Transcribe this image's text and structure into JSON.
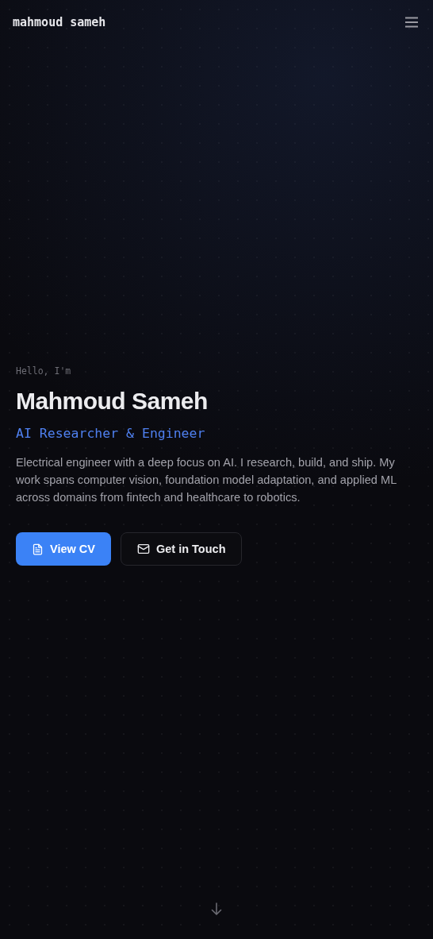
{
  "header": {
    "logo": "mahmoud sameh"
  },
  "hero": {
    "greeting": "Hello, I'm",
    "name": "Mahmoud Sameh",
    "role": "AI Researcher & Engineer",
    "bio": "Electrical engineer with a deep focus on AI. I research, build, and ship. My work spans computer vision, foundation model adaptation, and applied ML across domains from fintech and healthcare to robotics.",
    "buttons": [
      {
        "label": "View CV",
        "kind": "primary"
      },
      {
        "label": "Get in Touch",
        "kind": "secondary"
      }
    ]
  }
}
